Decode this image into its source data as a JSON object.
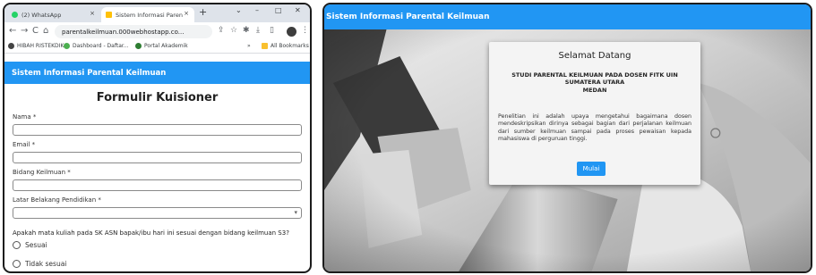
{
  "browser": {
    "tabs": [
      {
        "label": "(2) WhatsApp",
        "icon": "whatsapp-icon",
        "close": "×"
      },
      {
        "label": "Sistem Informasi Paren",
        "icon": "site-favicon",
        "close": "×"
      }
    ],
    "new_tab": "+",
    "window_controls": {
      "dropdown": "⌄",
      "minimize": "–",
      "maximize": "□",
      "close": "✕"
    },
    "nav": {
      "back": "←",
      "forward": "→",
      "reload": "C",
      "home": "⌂"
    },
    "url": "parentalkeilmuan.000webhostapp.co...",
    "toolbar_icons": [
      "share-icon",
      "star-icon",
      "extensions-icon",
      "download-icon",
      "sidepanel-icon",
      "profile-avatar",
      "menu-icon"
    ],
    "bookmarks": [
      {
        "label": "HIBAH RISTEKDIK",
        "icon": "bookmark-favicon"
      },
      {
        "label": "Dashboard - Daftar...",
        "icon": "bookmark-favicon"
      },
      {
        "label": "Portal Akademik",
        "icon": "bookmark-favicon"
      }
    ],
    "bookmarks_overflow": "»",
    "all_bookmarks": "All Bookmarks"
  },
  "site_title": "Sistem Informasi Parental Keilmuan",
  "form": {
    "title": "Formulir Kuisioner",
    "fields": [
      {
        "label": "Nama *",
        "value": ""
      },
      {
        "label": "Email *",
        "value": ""
      },
      {
        "label": "Bidang Keilmuan *",
        "value": ""
      },
      {
        "label": "Latar Belakang Pendidikan *",
        "value": ""
      }
    ],
    "select_arrow": "▾",
    "question": "Apakah mata kuliah pada SK ASN bapak/ibu hari ini sesuai dengan bidang keilmuan S3?",
    "options": [
      "Sesuai",
      "Tidak sesuai"
    ]
  },
  "welcome": {
    "title": "Selamat Datang",
    "subtitle_lines": [
      "STUDI PARENTAL KEILMUAN PADA DOSEN FITK UIN",
      "SUMATERA UTARA",
      "MEDAN"
    ],
    "body": "Penelitian ini adalah upaya mengetahui bagaimana dosen mendeskripsikan dirinya sebagai bagian dari perjalanan keilmuan dari sumber keilmuan sampai pada proses pewaisan kepada mahasiswa di perguruan tinggi.",
    "button": "Mulai"
  },
  "colors": {
    "brand_blue": "#2196f3",
    "tab_strip": "#dee3ea"
  }
}
